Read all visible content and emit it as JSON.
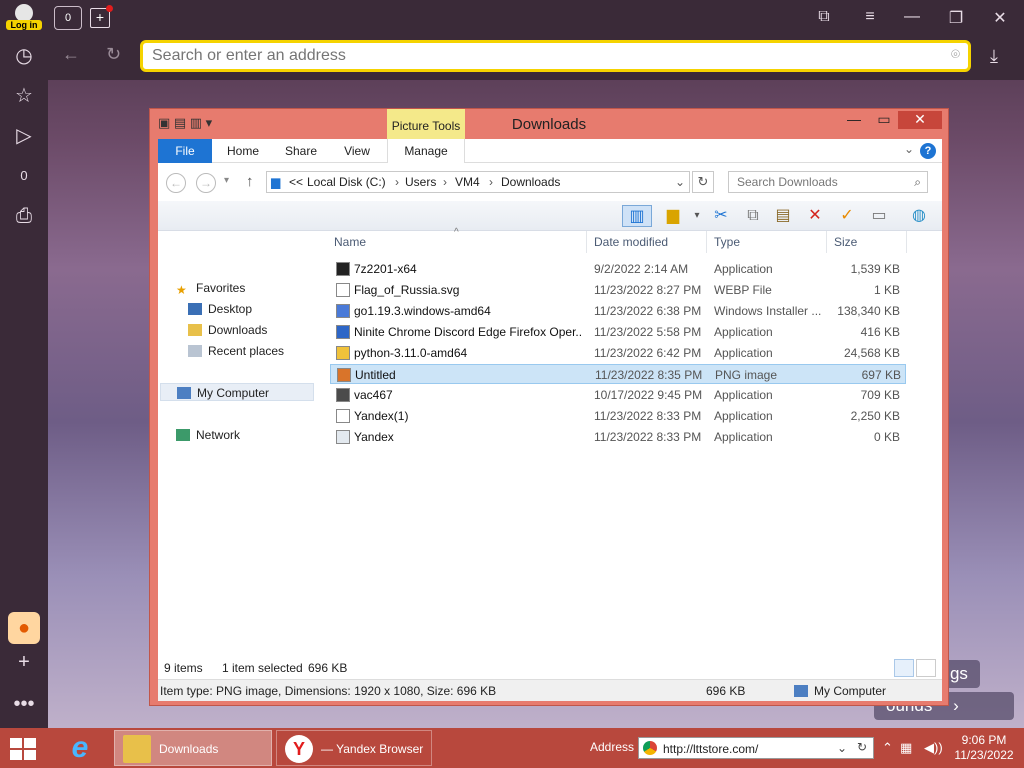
{
  "browser": {
    "login_label": "Log in",
    "home_tab_count": "0",
    "address_placeholder": "Search or enter an address",
    "sidebar_counter": "0",
    "bg_settings_partial": "tings",
    "bg_backgrounds_partial": "ounds",
    "colors": {
      "accent": "#f5d300",
      "chrome": "#3a2a38"
    }
  },
  "explorer": {
    "title": "Downloads",
    "contextual_tab": "Picture Tools",
    "ribbon_tabs": [
      "File",
      "Home",
      "Share",
      "View",
      "Manage"
    ],
    "breadcrumb": [
      "<<",
      "Local Disk (C:)",
      "Users",
      "VM4",
      "Downloads"
    ],
    "search_placeholder": "Search Downloads",
    "columns": {
      "name": "Name",
      "date": "Date modified",
      "type": "Type",
      "size": "Size"
    },
    "nav": {
      "favorites": "Favorites",
      "desktop": "Desktop",
      "downloads": "Downloads",
      "recent": "Recent places",
      "computer": "My Computer",
      "network": "Network"
    },
    "files": [
      {
        "name": "7z2201-x64",
        "date": "9/2/2022 2:14 AM",
        "type": "Application",
        "size": "1,539 KB",
        "icon": "7zip-icon"
      },
      {
        "name": "Flag_of_Russia.svg",
        "date": "11/23/2022 8:27 PM",
        "type": "WEBP File",
        "size": "1 KB",
        "icon": "file-icon"
      },
      {
        "name": "go1.19.3.windows-amd64",
        "date": "11/23/2022 6:38 PM",
        "type": "Windows Installer ...",
        "size": "138,340 KB",
        "icon": "installer-icon"
      },
      {
        "name": "Ninite Chrome Discord Edge Firefox Oper...",
        "date": "11/23/2022 5:58 PM",
        "type": "Application",
        "size": "416 KB",
        "icon": "ninite-icon"
      },
      {
        "name": "python-3.11.0-amd64",
        "date": "11/23/2022 6:42 PM",
        "type": "Application",
        "size": "24,568 KB",
        "icon": "python-icon"
      },
      {
        "name": "Untitled",
        "date": "11/23/2022 8:35 PM",
        "type": "PNG image",
        "size": "697 KB",
        "icon": "image-icon",
        "selected": true
      },
      {
        "name": "vac467",
        "date": "10/17/2022 9:45 PM",
        "type": "Application",
        "size": "709 KB",
        "icon": "vac-icon"
      },
      {
        "name": "Yandex(1)",
        "date": "11/23/2022 8:33 PM",
        "type": "Application",
        "size": "2,250 KB",
        "icon": "yandex-icon"
      },
      {
        "name": "Yandex",
        "date": "11/23/2022 8:33 PM",
        "type": "Application",
        "size": "0 KB",
        "icon": "app-icon"
      }
    ],
    "status": {
      "count": "9 items",
      "selected": "1 item selected",
      "selected_size": "696 KB"
    },
    "details": {
      "info": "Item type: PNG image, Dimensions: 1920 x 1080, Size: 696 KB",
      "size": "696 KB",
      "location": "My Computer"
    }
  },
  "taskbar": {
    "downloads_label": "Downloads",
    "yandex_label": "— Yandex Browser",
    "address_label": "Address",
    "address_value": "http://lttstore.com/",
    "time": "9:06 PM",
    "date": "11/23/2022"
  }
}
